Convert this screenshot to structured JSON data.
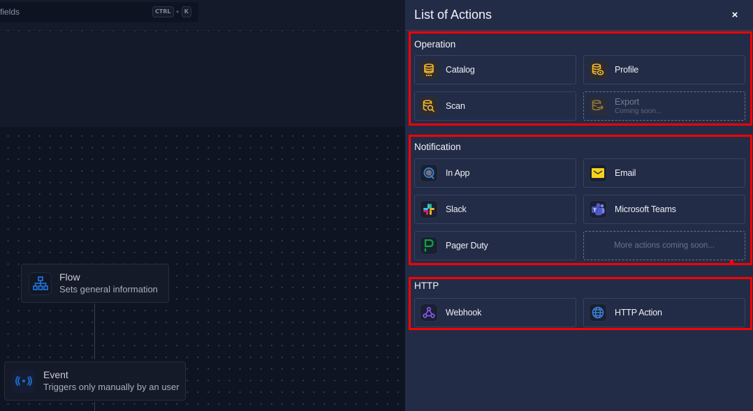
{
  "canvas": {
    "search": {
      "text": "d fields",
      "shortcut_keys": [
        "CTRL",
        "K"
      ],
      "shortcut_separator": "+"
    },
    "nodes": [
      {
        "title": "Flow",
        "subtitle": "Sets general information",
        "icon": "sitemap-icon"
      },
      {
        "title": "Event",
        "subtitle": "Triggers only manually by an user",
        "icon": "broadcast-icon"
      }
    ]
  },
  "panel": {
    "title": "List of Actions",
    "close_label": "×",
    "highlight_color": "#ff0000",
    "sections": [
      {
        "title": "Operation",
        "items": [
          {
            "label": "Catalog",
            "icon": "database-icon",
            "enabled": true
          },
          {
            "label": "Profile",
            "icon": "database-eye-icon",
            "enabled": true
          },
          {
            "label": "Scan",
            "icon": "database-search-icon",
            "enabled": true
          },
          {
            "label": "Export",
            "sublabel": "Coming soon...",
            "icon": "database-export-icon",
            "enabled": false
          }
        ]
      },
      {
        "title": "Notification",
        "items": [
          {
            "label": "In App",
            "icon": "in-app-icon",
            "enabled": true
          },
          {
            "label": "Email",
            "icon": "email-icon",
            "enabled": true
          },
          {
            "label": "Slack",
            "icon": "slack-icon",
            "enabled": true
          },
          {
            "label": "Microsoft Teams",
            "icon": "teams-icon",
            "enabled": true
          },
          {
            "label": "Pager Duty",
            "icon": "pagerduty-icon",
            "enabled": true
          },
          {
            "label": "More actions coming soon...",
            "placeholder": true
          }
        ]
      },
      {
        "title": "HTTP",
        "items": [
          {
            "label": "Webhook",
            "icon": "webhook-icon",
            "enabled": true
          },
          {
            "label": "HTTP Action",
            "icon": "globe-icon",
            "enabled": true
          }
        ]
      }
    ]
  }
}
